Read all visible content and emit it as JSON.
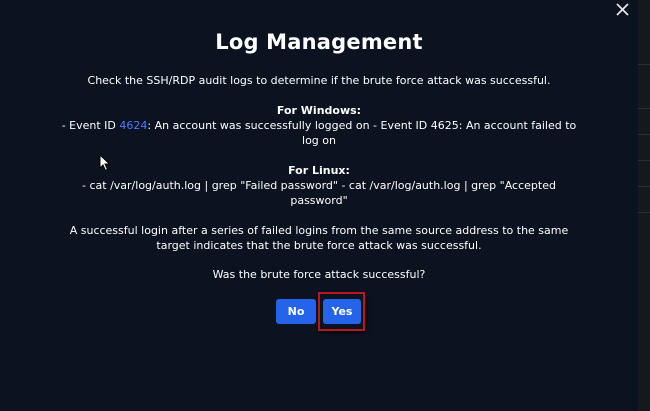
{
  "modal": {
    "title": "Log Management",
    "intro": "Check the SSH/RDP audit logs to determine if the brute force attack was successful.",
    "windows": {
      "heading": "For Windows:",
      "line_prefix": "- Event ID ",
      "event_link": "4624",
      "line_rest": ": An account was successfully logged on - Event ID 4625: An account failed to log on"
    },
    "linux": {
      "heading": "For Linux:",
      "line": "- cat /var/log/auth.log | grep \"Failed password\" - cat /var/log/auth.log | grep \"Accepted password\""
    },
    "explanation": "A successful login after a series of failed logins from the same source address to the same target indicates that the brute force attack was successful.",
    "question": "Was the brute force attack successful?",
    "buttons": {
      "no": "No",
      "yes": "Yes"
    }
  },
  "icons": {
    "close": "close-icon",
    "cursor": "mouse-cursor-icon"
  },
  "colors": {
    "background": "#0b1220",
    "button": "#2563eb",
    "link": "#4d7dff",
    "highlight": "#c0151d"
  }
}
